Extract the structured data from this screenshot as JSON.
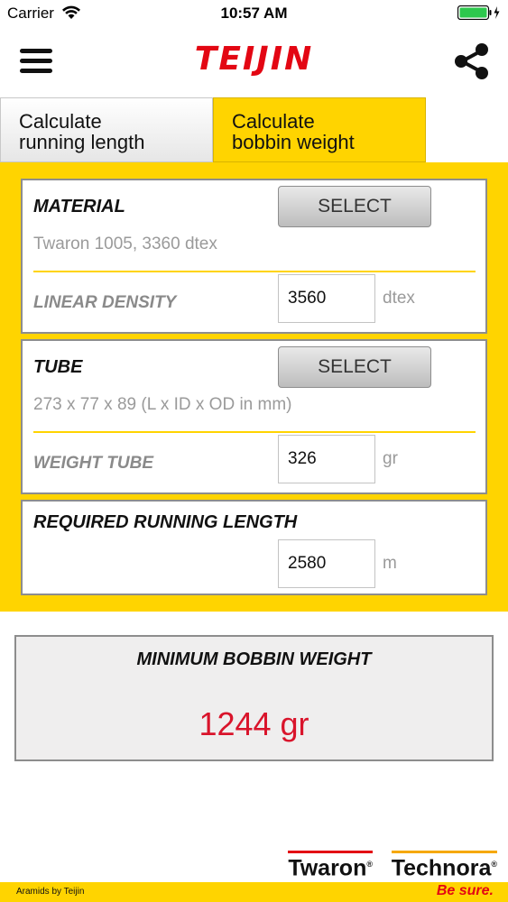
{
  "status_bar": {
    "carrier": "Carrier",
    "time": "10:57 AM"
  },
  "header": {
    "logo": "TEIJIN",
    "logo_color": "#e30613"
  },
  "tabs": [
    {
      "label_line1": "Calculate",
      "label_line2": "running length",
      "active": false
    },
    {
      "label_line1": "Calculate",
      "label_line2": "bobbin weight",
      "active": true
    }
  ],
  "material": {
    "title": "MATERIAL",
    "select_label": "SELECT",
    "description": "Twaron 1005, 3360 dtex",
    "field_label": "LINEAR DENSITY",
    "value": "3560",
    "unit": "dtex"
  },
  "tube": {
    "title": "TUBE",
    "select_label": "SELECT",
    "description": "273 x 77 x 89 (L x ID x OD in mm)",
    "field_label": "WEIGHT TUBE",
    "value": "326",
    "unit": "gr"
  },
  "running_length": {
    "title": "REQUIRED RUNNING LENGTH",
    "value": "2580",
    "unit": "m"
  },
  "result": {
    "title": "MINIMUM BOBBIN WEIGHT",
    "value": "1244 gr",
    "value_color": "#d9142b"
  },
  "footer": {
    "brand1": "Twaron",
    "brand2": "Technora",
    "left_text": "Aramids by Teijin",
    "right_text": "Be sure.",
    "accent_color": "#ffd400"
  },
  "icons": {
    "menu": "hamburger-menu-icon",
    "share": "share-icon",
    "wifi": "wifi-icon",
    "battery": "battery-icon"
  }
}
